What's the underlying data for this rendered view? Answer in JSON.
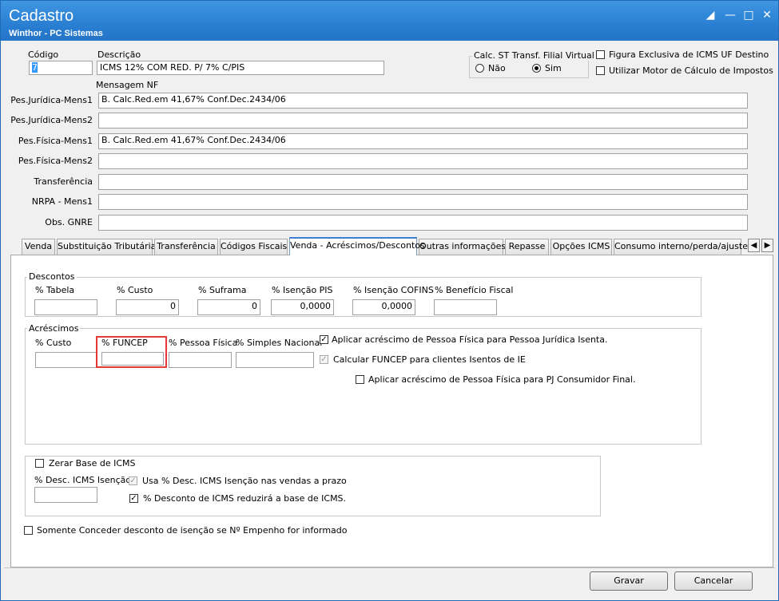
{
  "window": {
    "title": "Cadastro",
    "subtitle": "Winthor - PC Sistemas"
  },
  "header": {
    "codigo_label": "Código",
    "codigo_value": "7",
    "descricao_label": "Descrição",
    "descricao_value": "ICMS 12% COM RED. P/ 7% C/PIS",
    "mensagem_nf_label": "Mensagem NF",
    "calc_st_group": "Calc. ST Transf. Filial Virtual",
    "radio_nao": "Não",
    "radio_sim": "Sim",
    "radio_selected": "Sim",
    "chk_figura": "Figura Exclusiva de ICMS UF Destino",
    "chk_motor": "Utilizar Motor de Cálculo de Impostos"
  },
  "mensagens": [
    {
      "label": "Pes.Jurídica-Mens1",
      "value": "B. Calc.Red.em 41,67% Conf.Dec.2434/06"
    },
    {
      "label": "Pes.Jurídica-Mens2",
      "value": ""
    },
    {
      "label": "Pes.Física-Mens1",
      "value": "B. Calc.Red.em 41,67% Conf.Dec.2434/06"
    },
    {
      "label": "Pes.Física-Mens2",
      "value": ""
    },
    {
      "label": "Transferência",
      "value": ""
    },
    {
      "label": "NRPA - Mens1",
      "value": ""
    },
    {
      "label": "Obs. GNRE",
      "value": ""
    }
  ],
  "tabs": [
    {
      "label": "Venda"
    },
    {
      "label": "Substituição Tributária"
    },
    {
      "label": "Transferência"
    },
    {
      "label": "Códigos Fiscais"
    },
    {
      "label": "Venda - Acréscimos/Descontos"
    },
    {
      "label": "Outras informações"
    },
    {
      "label": "Repasse"
    },
    {
      "label": "Opções ICMS"
    },
    {
      "label": "Consumo interno/perda/ajuste"
    }
  ],
  "active_tab": "Venda - Acréscimos/Descontos",
  "descontos": {
    "title": "Descontos",
    "fields": [
      {
        "label": "% Tabela",
        "value": ""
      },
      {
        "label": "% Custo",
        "value": "0"
      },
      {
        "label": "% Suframa",
        "value": "0"
      },
      {
        "label": "% Isenção PIS",
        "value": "0,0000"
      },
      {
        "label": "% Isenção COFINS",
        "value": "0,0000"
      },
      {
        "label": "% Benefício Fiscal",
        "value": ""
      }
    ]
  },
  "acrescimos": {
    "title": "Acréscimos",
    "fields": [
      {
        "label": "% Custo",
        "value": ""
      },
      {
        "label": "% FUNCEP",
        "value": ""
      },
      {
        "label": "% Pessoa Física",
        "value": ""
      },
      {
        "label": "% Simples Nacional",
        "value": ""
      }
    ],
    "chk_aplicar_pf_pj": "Aplicar acréscimo de Pessoa Física para Pessoa Jurídica Isenta.",
    "chk_calcular_funcep": "Calcular FUNCEP para clientes Isentos de IE",
    "chk_aplicar_pf_consumidor": "Aplicar acréscimo de Pessoa Física para PJ Consumidor Final."
  },
  "icms": {
    "chk_zerar_base": "Zerar Base de ICMS",
    "desc_isencao_label": "% Desc. ICMS Isenção",
    "desc_isencao_value": "",
    "chk_usa_prazo": "Usa % Desc. ICMS Isenção nas vendas a prazo",
    "chk_reduzira_base": "% Desconto de ICMS reduzirá a base de ICMS."
  },
  "chk_empenho": "Somente Conceder desconto de isenção se Nº Empenho for informado",
  "buttons": {
    "gravar": "Gravar",
    "cancelar": "Cancelar"
  },
  "colors": {
    "titlebar": "#2a7fd2",
    "highlight": "#e53935",
    "selection": "#3399ff"
  }
}
